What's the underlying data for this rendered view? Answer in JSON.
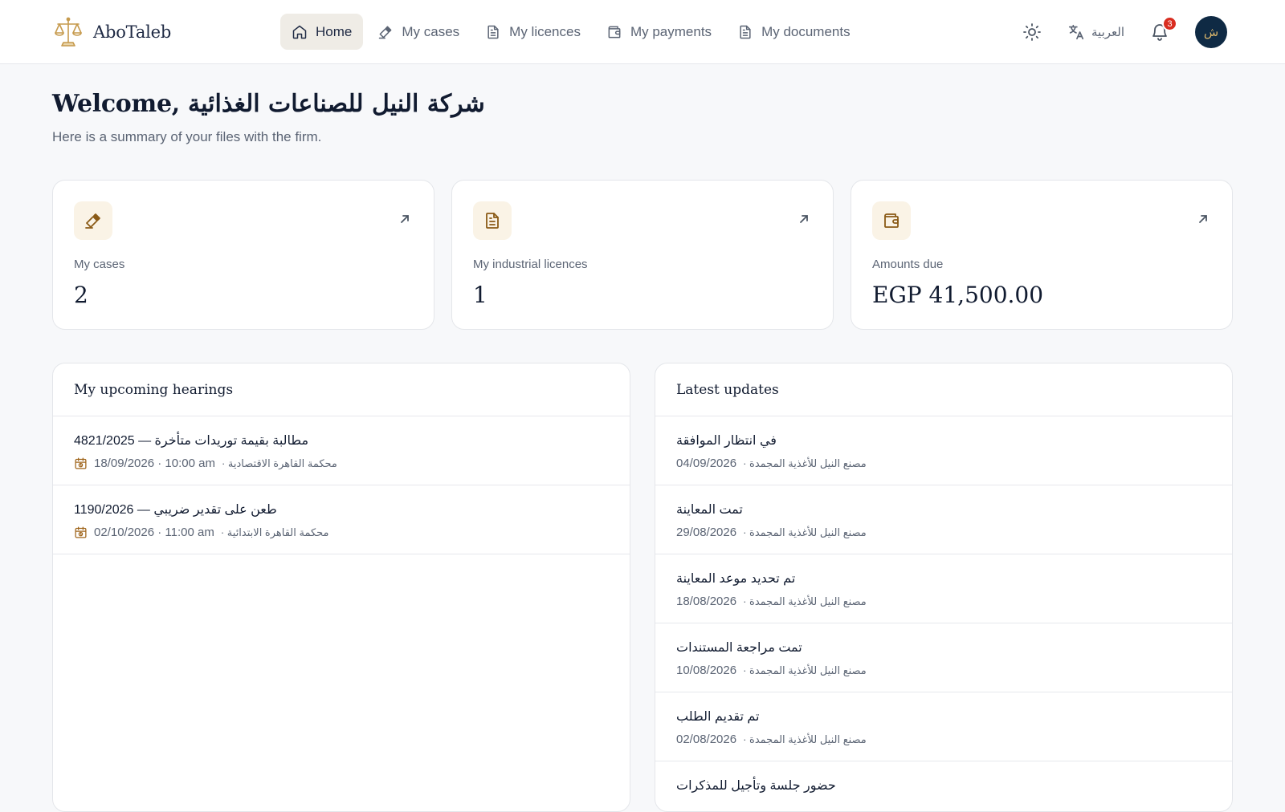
{
  "brand": {
    "name": "AboTaleb"
  },
  "nav": [
    {
      "label": "Home",
      "icon": "home-icon",
      "active": true
    },
    {
      "label": "My cases",
      "icon": "gavel-icon"
    },
    {
      "label": "My licences",
      "icon": "document-icon"
    },
    {
      "label": "My payments",
      "icon": "wallet-icon"
    },
    {
      "label": "My documents",
      "icon": "document-icon"
    }
  ],
  "header": {
    "language_label": "العربية",
    "notification_count": "3",
    "avatar_initial": "ش"
  },
  "welcome": {
    "title": "Welcome, شركة النيل للصناعات الغذائية",
    "subtitle": "Here is a summary of your files with the firm."
  },
  "stats": [
    {
      "label": "My cases",
      "value": "2",
      "icon": "gavel-icon"
    },
    {
      "label": "My industrial licences",
      "value": "1",
      "icon": "document-icon"
    },
    {
      "label": "Amounts due",
      "value": "EGP 41,500.00",
      "icon": "wallet-icon"
    }
  ],
  "hearings": {
    "title": "My upcoming hearings",
    "items": [
      {
        "title": "4821/2025 — مطالبة بقيمة توريدات متأخرة",
        "when": "18/09/2026 · 10:00 am",
        "court": "· محكمة القاهرة الاقتصادية"
      },
      {
        "title": "1190/2026 — طعن على تقدير ضريبي",
        "when": "02/10/2026 · 11:00 am",
        "court": "· محكمة القاهرة الابتدائية"
      }
    ]
  },
  "updates": {
    "title": "Latest updates",
    "items": [
      {
        "title": "في انتظار الموافقة",
        "date": "04/09/2026",
        "source": "· مصنع النيل للأغذية المجمدة"
      },
      {
        "title": "تمت المعاينة",
        "date": "29/08/2026",
        "source": "· مصنع النيل للأغذية المجمدة"
      },
      {
        "title": "تم تحديد موعد المعاينة",
        "date": "18/08/2026",
        "source": "· مصنع النيل للأغذية المجمدة"
      },
      {
        "title": "تمت مراجعة المستندات",
        "date": "10/08/2026",
        "source": "· مصنع النيل للأغذية المجمدة"
      },
      {
        "title": "تم تقديم الطلب",
        "date": "02/08/2026",
        "source": "· مصنع النيل للأغذية المجمدة"
      },
      {
        "title": "حضور جلسة وتأجيل للمذكرات",
        "date": "",
        "source": ""
      }
    ]
  },
  "colors": {
    "accent": "#a0661d",
    "navy": "#0f2a44",
    "badge": "#d92d20"
  }
}
